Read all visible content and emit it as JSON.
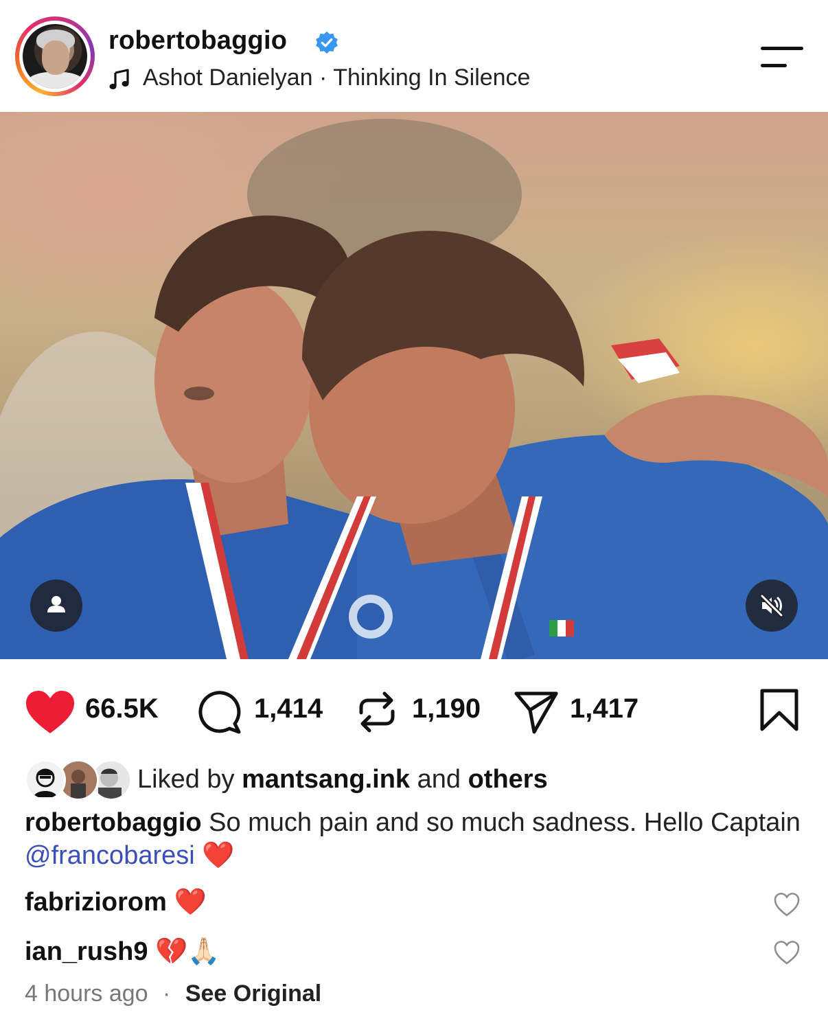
{
  "header": {
    "username": "robertobaggio",
    "verified": true,
    "music": "Ashot Danielyan · Thinking In Silence",
    "menu_icon": "menu-icon"
  },
  "post": {
    "media_type": "photo",
    "user_tag_icon": "person-icon",
    "audio_state_icon": "muted-speaker-icon"
  },
  "actions": {
    "likes": "66.5K",
    "comments": "1,414",
    "reposts": "1,190",
    "shares": "1,417",
    "liked": true,
    "like_color": "#ee1d35"
  },
  "liked_by": {
    "prefix": "Liked by",
    "user": "mantsang.ink",
    "joiner": "and",
    "others": "others"
  },
  "caption": {
    "author": "robertobaggio",
    "text": "So much pain and so much sadness. Hello Captain",
    "mention": "@francobaresi",
    "emoji": "❤️"
  },
  "comments": [
    {
      "user": "fabriziorom",
      "emoji": "❤️"
    },
    {
      "user": "ian_rush9",
      "emoji": "💔🙏🏻"
    }
  ],
  "meta": {
    "time": "4 hours ago",
    "separator": "·",
    "see_original": "See Original"
  },
  "colors": {
    "mention": "#3a4fb8",
    "verified": "#3897f0",
    "text": "#111111",
    "muted": "#777777"
  }
}
